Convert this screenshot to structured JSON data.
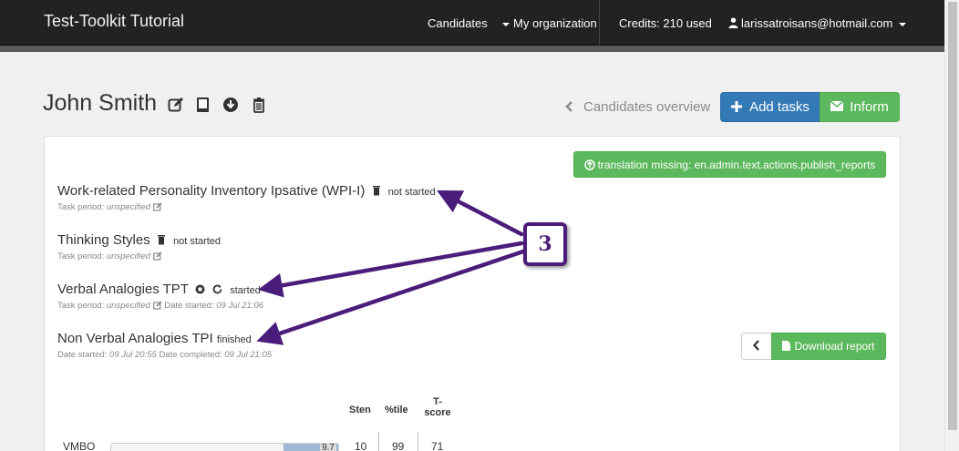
{
  "navbar": {
    "brand": "Test-Toolkit Tutorial",
    "candidates": "Candidates",
    "my_organization": "My organization",
    "credits": "Credits: 210 used",
    "user_email": "larissatroisans@hotmail.com"
  },
  "header": {
    "title": "John Smith",
    "overview_link": "Candidates overview",
    "add_tasks": "Add tasks",
    "inform": "Inform"
  },
  "panel": {
    "publish_button": "translation missing: en.admin.text.actions.publish_reports",
    "download_report": "Download report"
  },
  "tasks": [
    {
      "title": "Work-related Personality Inventory Ipsative (WPI-I)",
      "status": "not started",
      "period_label": "Task period:",
      "period_value": "unspecified"
    },
    {
      "title": "Thinking Styles",
      "status": "not started",
      "period_label": "Task period:",
      "period_value": "unspecified"
    },
    {
      "title": "Verbal Analogies TPT",
      "status": "started",
      "period_label": "Task period:",
      "period_value": "unspecified",
      "date_started_label": "Date started:",
      "date_started_value": "09 Jul 21:06"
    },
    {
      "title": "Non Verbal Analogies TPI",
      "status": "finished",
      "date_started_label": "Date started:",
      "date_started_value": "09 Jul 20:55",
      "date_completed_label": "Date completed:",
      "date_completed_value": "09 Jul 21:05"
    }
  ],
  "score_table": {
    "headers": {
      "sten": "Sten",
      "percentile": "%tile",
      "tscore_1": "T-",
      "tscore_2": "score"
    },
    "row": {
      "label": "VMBO",
      "bar_value": "9.7",
      "bar_fraction": 0.24,
      "sten": "10",
      "percentile": "99",
      "tscore": "71"
    }
  },
  "callout": {
    "number": "3"
  },
  "colors": {
    "navbar": "#222222",
    "primary": "#337ab7",
    "success": "#5cb85c",
    "annotation": "#4b1d7a"
  }
}
